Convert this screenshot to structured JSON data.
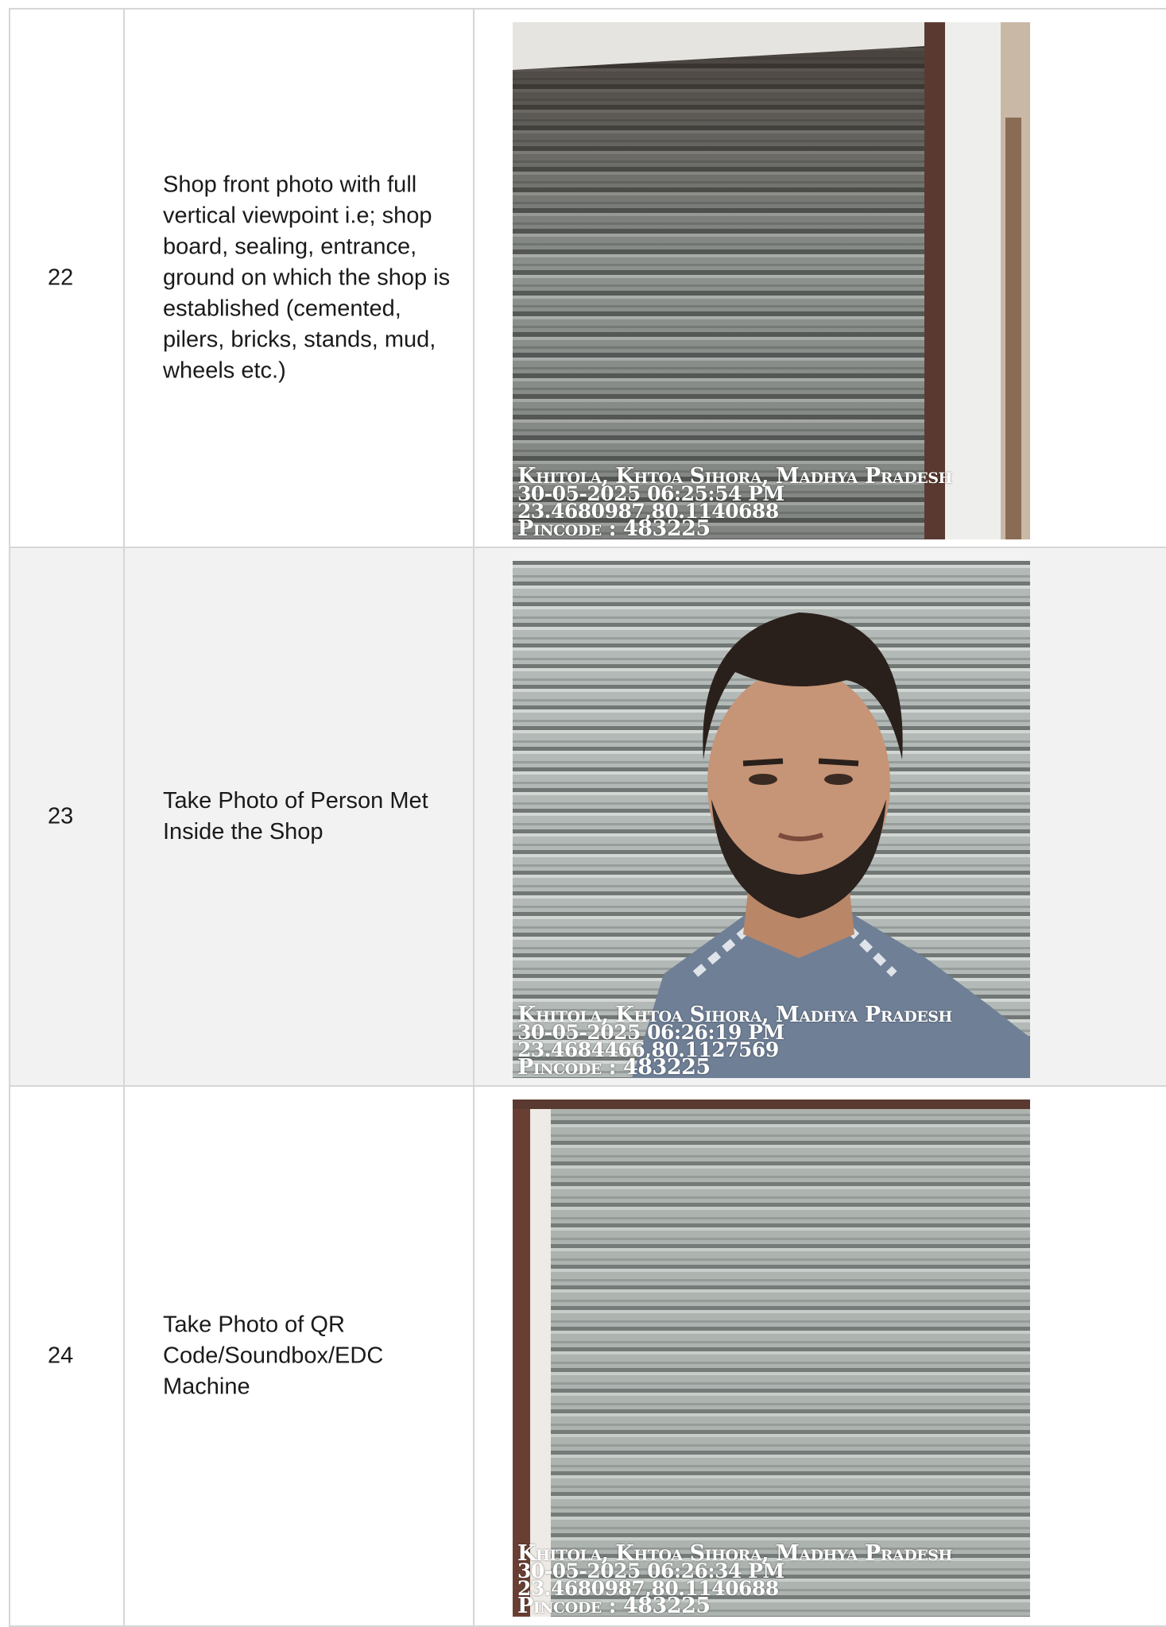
{
  "rows": [
    {
      "number": "22",
      "description": "Shop front photo with full vertical viewpoint i.e; shop board, sealing, entrance, ground on which the shop is established (cemented, pilers, bricks, stands, mud, wheels etc.)",
      "photo": {
        "subject": "shop-front-shutter",
        "location": "Khitola, Khtoa Sihora, Madhya Pradesh",
        "datetime": "30-05-2025 06:25:54 PM",
        "coordinates": "23.4680987,80.1140688",
        "pincode": "Pincode : 483225"
      }
    },
    {
      "number": "23",
      "description": "Take Photo of Person Met Inside the Shop",
      "photo": {
        "subject": "person-portrait",
        "location": "Khitola, Khtoa Sihora, Madhya Pradesh",
        "datetime": "30-05-2025 06:26:19 PM",
        "coordinates": "23.4684466,80.1127569",
        "pincode": "Pincode : 483225"
      }
    },
    {
      "number": "24",
      "description": "Take Photo of QR Code/Soundbox/EDC Machine",
      "photo": {
        "subject": "closed-shutter",
        "location": "Khitola, Khtoa Sihora, Madhya Pradesh",
        "datetime": "30-05-2025 06:26:34 PM",
        "coordinates": "23.4680987,80.1140688",
        "pincode": "Pincode : 483225"
      }
    }
  ]
}
